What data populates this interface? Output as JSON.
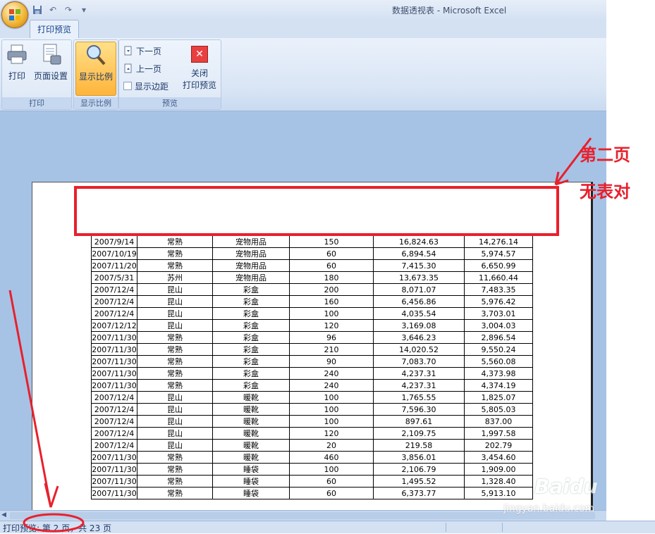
{
  "window": {
    "title": "数据透视表 - Microsoft Excel"
  },
  "ribbon": {
    "tab": "打印预览",
    "groups": {
      "print": {
        "label": "打印",
        "print_btn": "打印",
        "page_setup_btn": "页面设置"
      },
      "zoom": {
        "label": "显示比例",
        "zoom_btn": "显示比例"
      },
      "preview": {
        "label": "预览",
        "next_page": "下一页",
        "prev_page": "上一页",
        "show_margins": "显示边距",
        "close_line1": "关闭",
        "close_line2": "打印预览"
      }
    }
  },
  "icons": [
    "office-button-icon",
    "save-icon",
    "undo-icon",
    "redo-icon",
    "customize-icon",
    "printer-icon",
    "page-setup-icon",
    "magnifier-icon",
    "next-page-icon",
    "prev-page-icon",
    "close-preview-icon"
  ],
  "colors": {
    "accent_red": "#e8202c",
    "ribbon_blue": "#d4e1f3",
    "workspace_blue": "#a6c3e6"
  },
  "table": {
    "rows": [
      [
        "2007/9/14",
        "常熟",
        "宠物用品",
        "150",
        "16,824.63",
        "14,276.14"
      ],
      [
        "2007/10/19",
        "常熟",
        "宠物用品",
        "60",
        "6,894.54",
        "5,974.57"
      ],
      [
        "2007/11/20",
        "常熟",
        "宠物用品",
        "60",
        "7,415.30",
        "6,650.99"
      ],
      [
        "2007/5/31",
        "苏州",
        "宠物用品",
        "180",
        "13,673.35",
        "11,660.44"
      ],
      [
        "2007/12/4",
        "昆山",
        "彩盒",
        "200",
        "8,071.07",
        "7,483.35"
      ],
      [
        "2007/12/4",
        "昆山",
        "彩盒",
        "160",
        "6,456.86",
        "5,976.42"
      ],
      [
        "2007/12/4",
        "昆山",
        "彩盒",
        "100",
        "4,035.54",
        "3,703.01"
      ],
      [
        "2007/12/12",
        "昆山",
        "彩盒",
        "120",
        "3,169.08",
        "3,004.03"
      ],
      [
        "2007/11/30",
        "常熟",
        "彩盒",
        "96",
        "3,646.23",
        "2,896.54"
      ],
      [
        "2007/11/30",
        "常熟",
        "彩盒",
        "210",
        "14,020.52",
        "9,550.24"
      ],
      [
        "2007/11/30",
        "常熟",
        "彩盒",
        "90",
        "7,083.70",
        "5,560.08"
      ],
      [
        "2007/11/30",
        "常熟",
        "彩盒",
        "240",
        "4,237.31",
        "4,373.98"
      ],
      [
        "2007/11/30",
        "常熟",
        "彩盒",
        "240",
        "4,237.31",
        "4,374.19"
      ],
      [
        "2007/12/4",
        "昆山",
        "暖靴",
        "100",
        "1,765.55",
        "1,825.07"
      ],
      [
        "2007/12/4",
        "昆山",
        "暖靴",
        "100",
        "7,596.30",
        "5,805.03"
      ],
      [
        "2007/12/4",
        "昆山",
        "暖靴",
        "100",
        "897.61",
        "837.00"
      ],
      [
        "2007/12/4",
        "昆山",
        "暖靴",
        "120",
        "2,109.75",
        "1,997.58"
      ],
      [
        "2007/12/4",
        "昆山",
        "暖靴",
        "20",
        "219.58",
        "202.79"
      ],
      [
        "2007/11/30",
        "常熟",
        "暖靴",
        "460",
        "3,856.01",
        "3,454.60"
      ],
      [
        "2007/11/30",
        "常熟",
        "睡袋",
        "100",
        "2,106.79",
        "1,909.00"
      ],
      [
        "2007/11/30",
        "常熟",
        "睡袋",
        "60",
        "1,495.52",
        "1,328.40"
      ],
      [
        "2007/11/30",
        "常熟",
        "睡袋",
        "60",
        "6,373.77",
        "5,913.10"
      ]
    ]
  },
  "annotation": {
    "line1": "第二页",
    "line2": "无表对"
  },
  "status": {
    "text": "打印预览: 第 2 页，共 23 页"
  },
  "watermark": {
    "brand": "Baidu",
    "sub": "jingyan.baidu.com"
  }
}
